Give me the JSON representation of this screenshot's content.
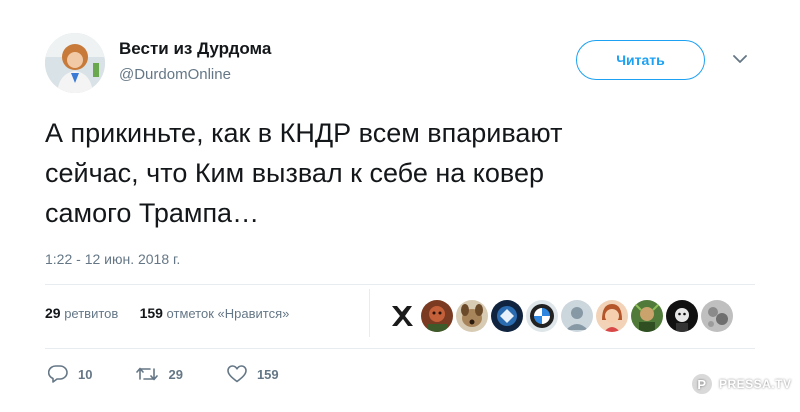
{
  "author": {
    "name": "Вести из Дурдома",
    "handle": "@DurdomOnline"
  },
  "follow_button": {
    "label": "Читать",
    "color": "#1da1f2"
  },
  "tweet": {
    "text": "А прикиньте, как в КНДР всем впаривают\nсейчас, что Ким вызвал к себе на ковер\nсамого Трампа…",
    "timestamp": "1:22 - 12 июн. 2018 г."
  },
  "stats": {
    "retweets_count": "29",
    "retweets_label": "ретвитов",
    "likes_count": "159",
    "likes_label": "отметок «Нравится»"
  },
  "likers": [
    {
      "icon": "x-logo-avatar"
    },
    {
      "icon": "red-portrait-avatar"
    },
    {
      "icon": "dog-avatar"
    },
    {
      "icon": "blue-logo-avatar"
    },
    {
      "icon": "bmw-logo-avatar"
    },
    {
      "icon": "default-avatar"
    },
    {
      "icon": "woman-portrait-avatar"
    },
    {
      "icon": "green-avatar"
    },
    {
      "icon": "dark-avatar"
    },
    {
      "icon": "sand-avatar"
    }
  ],
  "actions": {
    "replies": "10",
    "retweets": "29",
    "likes": "159"
  },
  "watermark": {
    "letter": "P",
    "text": "PRESSA.TV"
  }
}
